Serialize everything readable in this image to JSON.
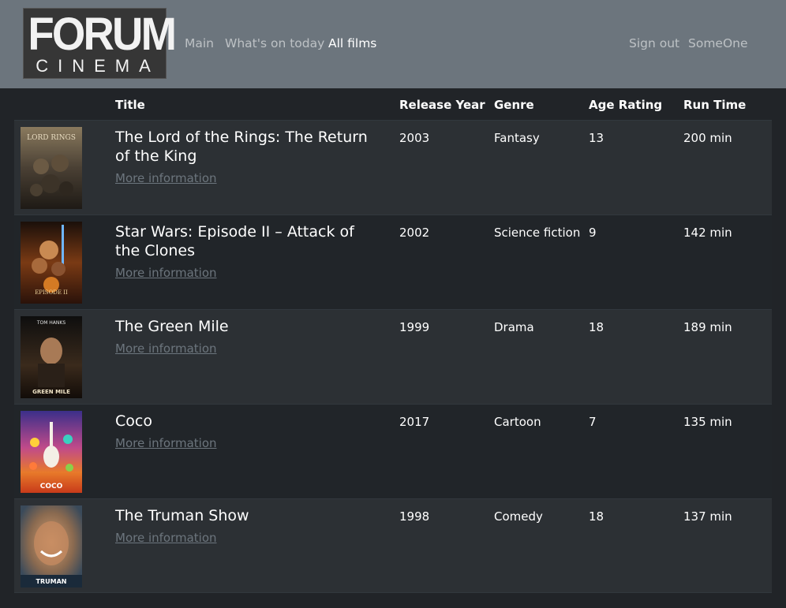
{
  "brand": {
    "top": "FORUM",
    "bottom": "CINEMA"
  },
  "nav": {
    "main": "Main",
    "today": "What's on today",
    "all_films": "All films",
    "sign_out": "Sign out",
    "user": "SomeOne"
  },
  "table": {
    "headers": {
      "title": "Title",
      "year": "Release Year",
      "genre": "Genre",
      "age": "Age Rating",
      "runtime": "Run Time"
    },
    "more_label": "More information",
    "rows": [
      {
        "title": "The Lord of the Rings: The Return of the King",
        "year": "2003",
        "genre": "Fantasy",
        "age": "13",
        "runtime": "200 min",
        "poster_text": "LORD RINGS"
      },
      {
        "title": "Star Wars: Episode II – Attack of the Clones",
        "year": "2002",
        "genre": "Science fiction",
        "age": "9",
        "runtime": "142 min",
        "poster_text": "EPISODE II"
      },
      {
        "title": "The Green Mile",
        "year": "1999",
        "genre": "Drama",
        "age": "18",
        "runtime": "189 min",
        "poster_text": "GREEN MILE"
      },
      {
        "title": "Coco",
        "year": "2017",
        "genre": "Cartoon",
        "age": "7",
        "runtime": "135 min",
        "poster_text": "COCO"
      },
      {
        "title": "The Truman Show",
        "year": "1998",
        "genre": "Comedy",
        "age": "18",
        "runtime": "137 min",
        "poster_text": "TRUMAN"
      }
    ]
  },
  "colors": {
    "navbar": "#6c757d",
    "page_bg": "#212428",
    "row_odd": "#2c3034",
    "link_muted": "#6c757d"
  }
}
